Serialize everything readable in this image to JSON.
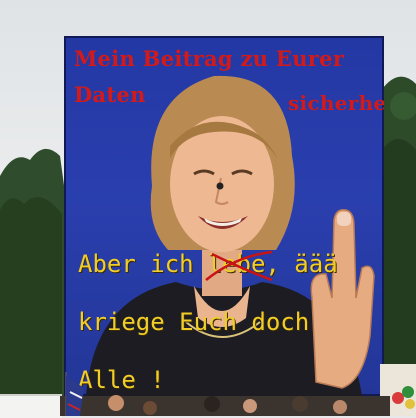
{
  "poster": {
    "headline_line1": "Mein Beitrag zu Eurer",
    "headline_line2_left": "Daten",
    "headline_line2_right": "sicherheit",
    "slogan_line1_a": "Aber ich",
    "slogan_line1_struck": "lebe",
    "slogan_line1_b": ", äää",
    "slogan_line2": "kriege Euch doch",
    "slogan_line3": "Alle !"
  },
  "colors": {
    "poster_background": "#2a3fae",
    "headline": "#d21a1a",
    "slogan": "#f0cd2a",
    "strike": "#c81414",
    "sky": "#e6e8ea",
    "trees": "#2b4a2a"
  },
  "objects": [
    "tree-line",
    "protest-poster",
    "portrait-figure",
    "raised-hand",
    "crowd",
    "flag",
    "tent",
    "balloons"
  ]
}
